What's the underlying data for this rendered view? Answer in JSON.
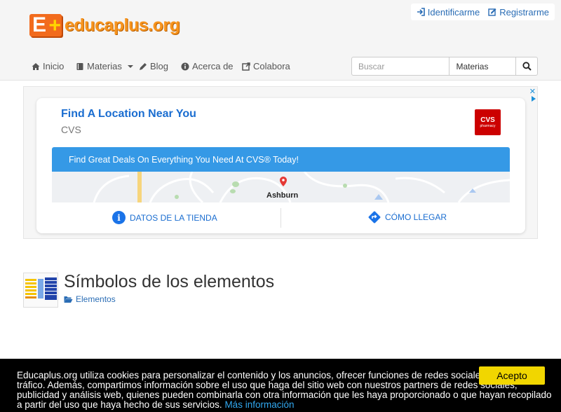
{
  "header": {
    "logo_text": "educaplus",
    "logo_tld": ".org",
    "login_label": "Identificarme",
    "register_label": "Registrarme"
  },
  "nav": {
    "items": [
      {
        "label": "Inicio",
        "icon": "home-icon"
      },
      {
        "label": "Materias",
        "icon": "book-icon"
      },
      {
        "label": "Blog",
        "icon": "pencil-icon"
      },
      {
        "label": "Acerca de",
        "icon": "info-icon"
      },
      {
        "label": "Colabora",
        "icon": "share-icon"
      }
    ]
  },
  "search": {
    "placeholder": "Buscar",
    "category": "Materias"
  },
  "ad": {
    "title": "Find A Location Near You",
    "subtitle": "CVS",
    "logo_text": "CVS",
    "logo_sub": "pharmacy",
    "banner": "Find Great Deals On Everything You Need At CVS® Today!",
    "map_label": "Ashburn",
    "action_store": "DATOS DE LA TIENDA",
    "action_directions": "CÓMO LLEGAR",
    "close_glyph": "✕"
  },
  "content": {
    "title": "Símbolos de los elementos",
    "category": "Elementos"
  },
  "cookie": {
    "text": "Educaplus.org utiliza cookies para personalizar el contenido y los anuncios, ofrecer funciones de redes sociales y analizar el tráfico. Además, compartimos información sobre el uso que haga del sitio web con nuestros partners de redes sociales, publicidad y análisis web, quienes pueden combinarla con otra información que les haya proporcionado o que hayan recopilado a partir del uso que haya hecho de sus servicios.",
    "link": "Más información",
    "accept": "Acepto"
  },
  "colors": {
    "link": "#2a6db5",
    "ad_blue": "#3599e6",
    "cookie_button": "#f1d600",
    "logo_orange": "#f26b1d"
  }
}
